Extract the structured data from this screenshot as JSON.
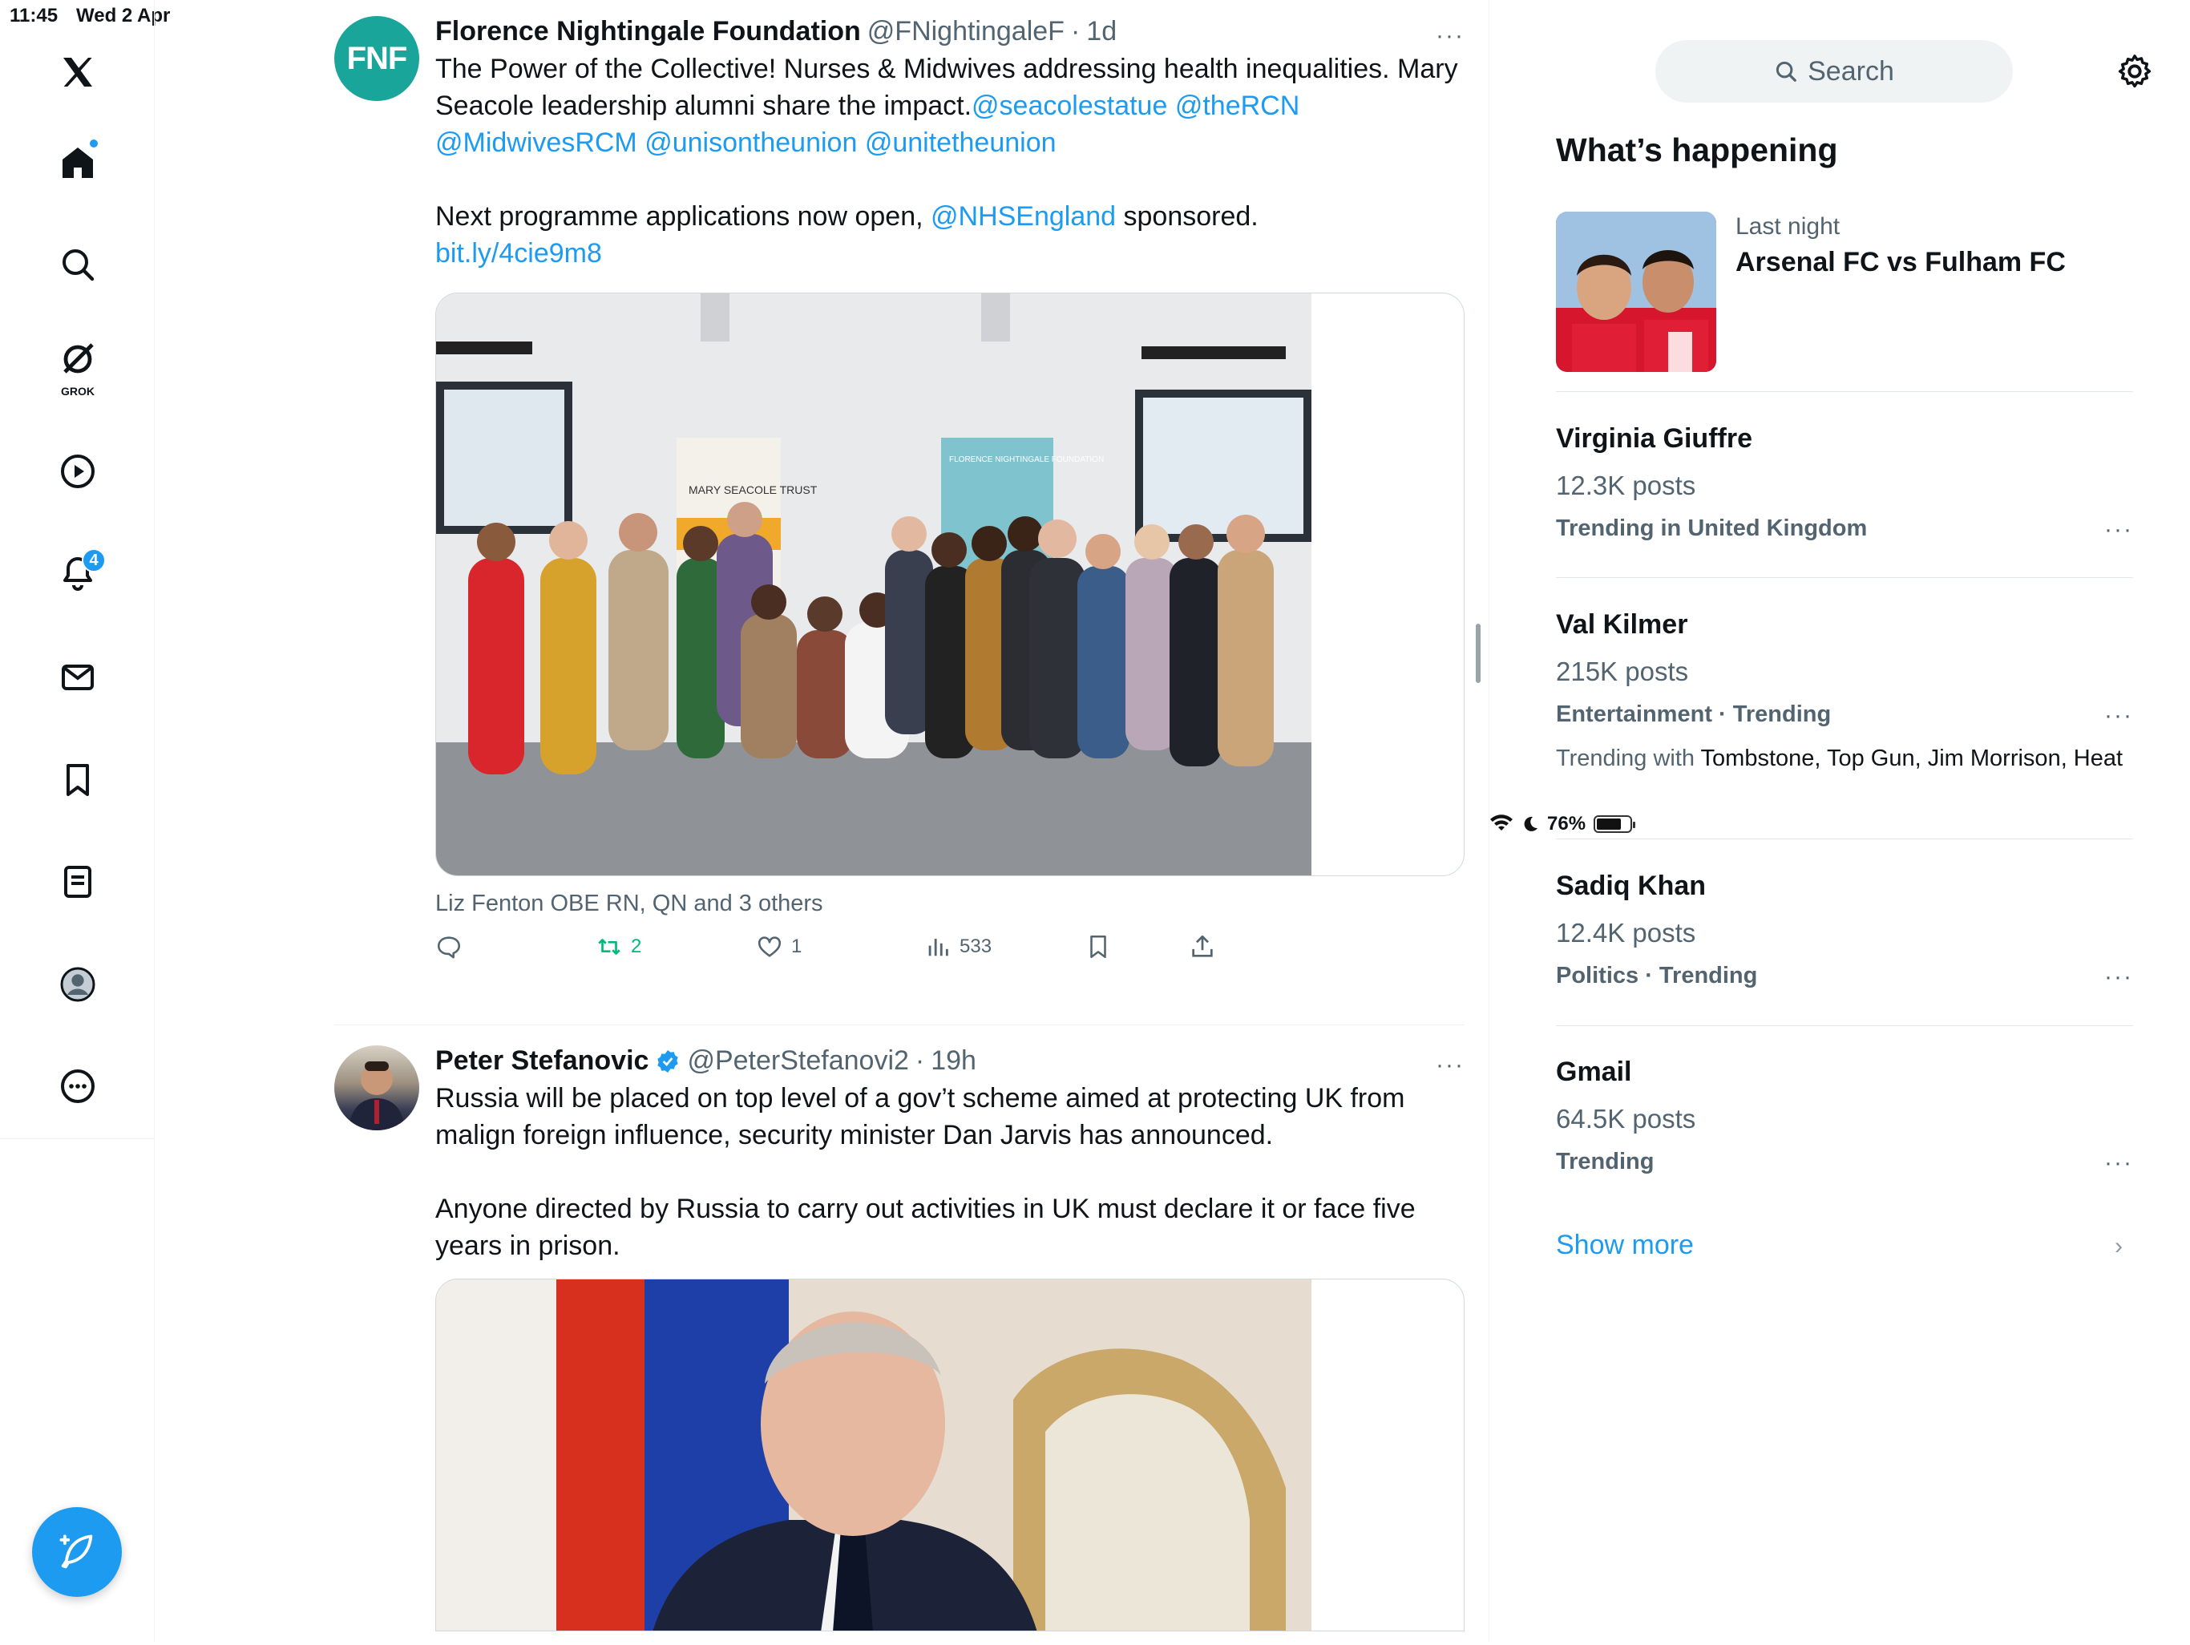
{
  "status_bar": {
    "time": "11:45",
    "date": "Wed 2 Apr",
    "battery": "76%",
    "battery_level": 0.76
  },
  "nav": {
    "grok_label": "GROK",
    "notifications_count": "4"
  },
  "tweets": [
    {
      "avatar_text": "FNF",
      "name": "Florence Nightingale Foundation",
      "handle": "@FNightingaleF",
      "dot": "·",
      "time": "1d",
      "more": "···",
      "text_p1": "The Power of the Collective! Nurses & Midwives addressing health inequalities. Mary Seacole leadership alumni share the impact.",
      "mentions": [
        "@seacolestatue",
        "@theRCN",
        "@MidwivesRCM",
        "@unisontheunion",
        "@unitetheunion"
      ],
      "text_p2_prefix": "Next programme applications now open, ",
      "text_p2_mention": "@NHSEngland",
      "text_p2_suffix": " sponsored.",
      "link": "bit.ly/4cie9m8",
      "media_banner_left": "MARY SEACOLE TRUST",
      "media_banner_right": "FLORENCE NIGHTINGALE FOUNDATION",
      "liked_by": "Liz Fenton OBE RN, QN and 3 others",
      "reposts": "2",
      "likes": "1",
      "views": "533"
    },
    {
      "name": "Peter Stefanovic",
      "handle": "@PeterStefanovi2",
      "dot": "·",
      "time": "19h",
      "more": "···",
      "text_p1": "Russia will be placed on top level of a gov’t scheme aimed at protecting UK from malign foreign influence, security minister Dan Jarvis has announced.",
      "text_p2": "Anyone directed by Russia to carry out activities in UK must declare it or face five years in prison."
    }
  ],
  "right": {
    "search_placeholder": "Search",
    "whats_happening": "What’s happening",
    "feature": {
      "meta": "Last night",
      "title": "Arsenal FC vs Fulham FC"
    },
    "trends": [
      {
        "name": "Virginia Giuffre",
        "posts": "12.3K posts",
        "category": "Trending in United Kingdom"
      },
      {
        "name": "Val Kilmer",
        "posts": "215K posts",
        "category": "Entertainment · Trending",
        "with_label": "Trending with ",
        "with_items": "Tombstone, Top Gun, Jim Morrison, Heat"
      },
      {
        "name": "Sadiq Khan",
        "posts": "12.4K posts",
        "category": "Politics · Trending"
      },
      {
        "name": "Gmail",
        "posts": "64.5K posts",
        "category": "Trending"
      }
    ],
    "trend_more": "···",
    "show_more": "Show more",
    "chevron": "›"
  },
  "colors": {
    "accent": "#1d9bf0",
    "repost": "#00ba7c",
    "muted": "#536471"
  }
}
